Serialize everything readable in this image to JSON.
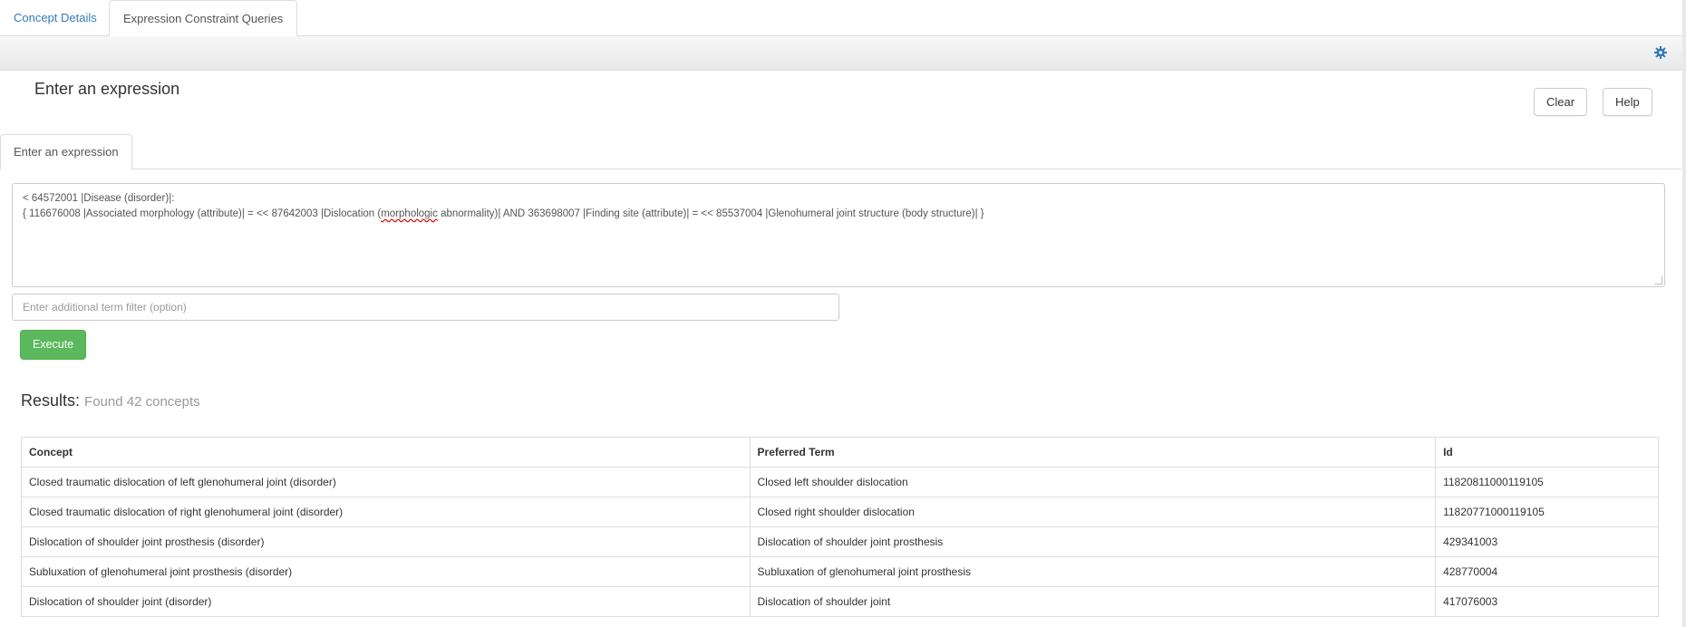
{
  "top_tabs": [
    {
      "label": "Concept Details"
    },
    {
      "label": "Expression Constraint Queries"
    }
  ],
  "header": {
    "title": "Enter an expression",
    "clear_label": "Clear",
    "help_label": "Help"
  },
  "inner_tab": {
    "label": "Enter an expression"
  },
  "expression": {
    "line1": "< 64572001 |Disease (disorder)|:",
    "line2_pre": "{ 116676008 |Associated morphology (attribute)| = << 87642003 |Dislocation (",
    "line2_flag": "morphologic",
    "line2_post": " abnormality)| AND 363698007 |Finding site (attribute)| = << 85537004 |Glenohumeral joint structure (body structure)| }"
  },
  "filter": {
    "placeholder": "Enter additional term filter (option)"
  },
  "execute_label": "Execute",
  "results": {
    "label": "Results:",
    "count_text": "Found 42 concepts",
    "columns": [
      "Concept",
      "Preferred Term",
      "Id"
    ],
    "rows": [
      [
        "Closed traumatic dislocation of left glenohumeral joint (disorder)",
        "Closed left shoulder dislocation",
        "11820811000119105"
      ],
      [
        "Closed traumatic dislocation of right glenohumeral joint (disorder)",
        "Closed right shoulder dislocation",
        "11820771000119105"
      ],
      [
        "Dislocation of shoulder joint prosthesis (disorder)",
        "Dislocation of shoulder joint prosthesis",
        "429341003"
      ],
      [
        "Subluxation of glenohumeral joint prosthesis (disorder)",
        "Subluxation of glenohumeral joint prosthesis",
        "428770004"
      ],
      [
        "Dislocation of shoulder joint (disorder)",
        "Dislocation of shoulder joint",
        "417076003"
      ]
    ]
  },
  "colors": {
    "link": "#337ab7",
    "execute": "#5cb85c",
    "gear": "#337ab7"
  },
  "icons": {
    "settings": "gear-icon"
  }
}
